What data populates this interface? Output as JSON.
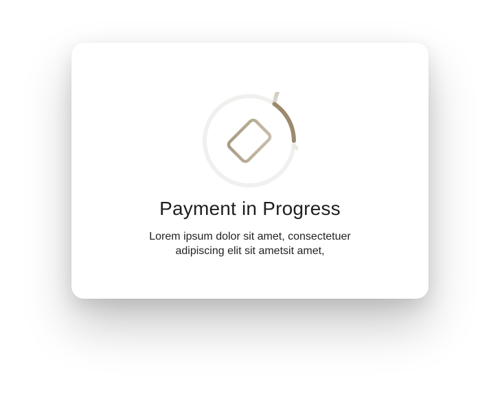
{
  "modal": {
    "title": "Payment in Progress",
    "description_line1": "Lorem ipsum dolor sit amet, consectetuer",
    "description_line2": "adipiscing elit sit ametsit amet,"
  },
  "spinner": {
    "icon": "credit-card-icon",
    "accent_color": "#9b8a6c",
    "track_color": "#efeeec"
  }
}
